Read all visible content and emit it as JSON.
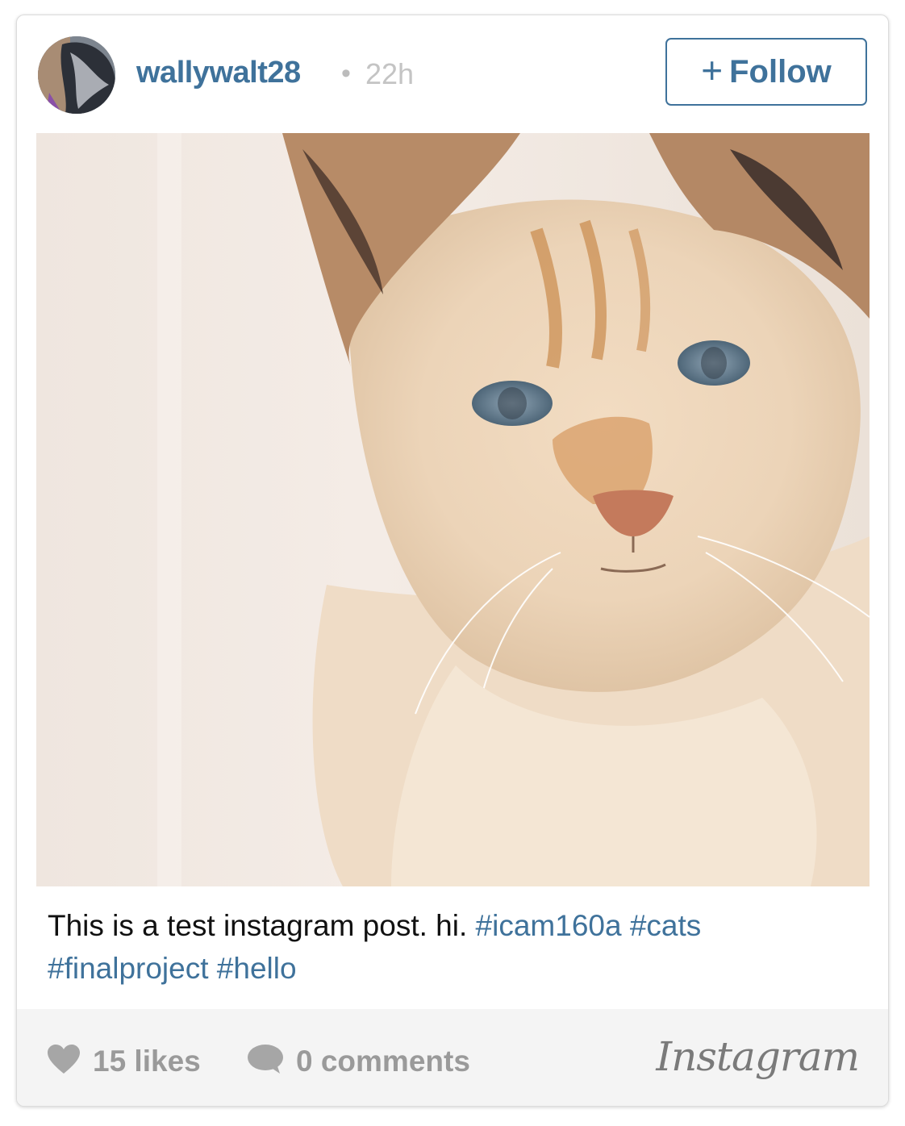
{
  "post": {
    "username": "wallywalt28",
    "separator": "•",
    "time": "22h",
    "follow_plus": "+",
    "follow_label": "Follow"
  },
  "caption": {
    "text": "This is a test instagram post. hi.",
    "hashtags": [
      "#icam160a",
      "#cats",
      "#finalproject",
      "#hello"
    ]
  },
  "footer": {
    "likes": "15 likes",
    "comments": "0 comments",
    "brand": "Instagram"
  },
  "icons": {
    "heart": "heart-icon",
    "comment": "comment-bubble-icon"
  },
  "colors": {
    "accent": "#3f729b",
    "muted": "#9a9a9a",
    "footer_bg": "#f4f4f4"
  }
}
